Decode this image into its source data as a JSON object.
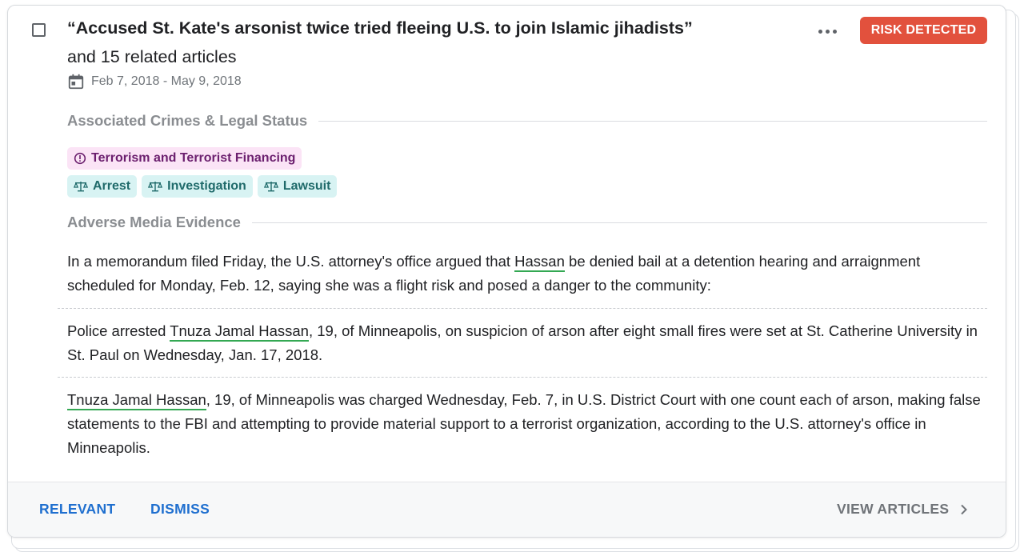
{
  "card": {
    "title": "“Accused St. Kate's arsonist twice tried fleeing U.S. to join Islamic jihadists”",
    "subtitle": "and 15 related articles",
    "date_range": "Feb 7, 2018 - May 9, 2018",
    "icons": {
      "checkbox": "checkbox-icon",
      "calendar": "calendar-icon",
      "more": "more-horizontal-icon",
      "alert": "alert-circle-icon",
      "scales": "scales-icon",
      "chevron": "chevron-right-icon"
    },
    "risk_badge": "RISK DETECTED",
    "colors": {
      "risk": "#e2513d",
      "terrorism_chip_bg": "#fbe4f6",
      "terrorism_chip_text": "#6b1f6e",
      "legal_chip_bg": "#d8f3f3",
      "legal_chip_text": "#1f6a6a",
      "entity_underline": "#34a853",
      "action_blue": "#1f6fcf"
    }
  },
  "crimes_section": {
    "heading": "Associated Crimes & Legal Status",
    "crime_tag": "Terrorism and Terrorist Financing",
    "legal_tags": [
      "Arrest",
      "Investigation",
      "Lawsuit"
    ]
  },
  "evidence_section": {
    "heading": "Adverse Media Evidence",
    "items": [
      {
        "before": "In a memorandum filed Friday, the U.S. attorney's office argued that ",
        "entity": "Hassan",
        "after": " be denied bail at a detention hearing and arraignment scheduled for Monday, Feb. 12, saying she was a flight risk and posed a danger to the community:"
      },
      {
        "before": "Police arrested ",
        "entity": "Tnuza Jamal Hassan",
        "after": ", 19, of Minneapolis, on suspicion of arson after eight small fires were set at St. Catherine University in St. Paul on Wednesday, Jan. 17, 2018."
      },
      {
        "before": "",
        "entity": "Tnuza Jamal Hassan",
        "after": ", 19, of Minneapolis was charged Wednesday, Feb. 7, in U.S. District Court with one count each of arson, making false statements to the FBI and attempting to provide material support to a terrorist organization, according to the U.S. attorney's office in Minneapolis."
      }
    ]
  },
  "footer": {
    "relevant": "RELEVANT",
    "dismiss": "DISMISS",
    "view_articles": "VIEW ARTICLES"
  }
}
